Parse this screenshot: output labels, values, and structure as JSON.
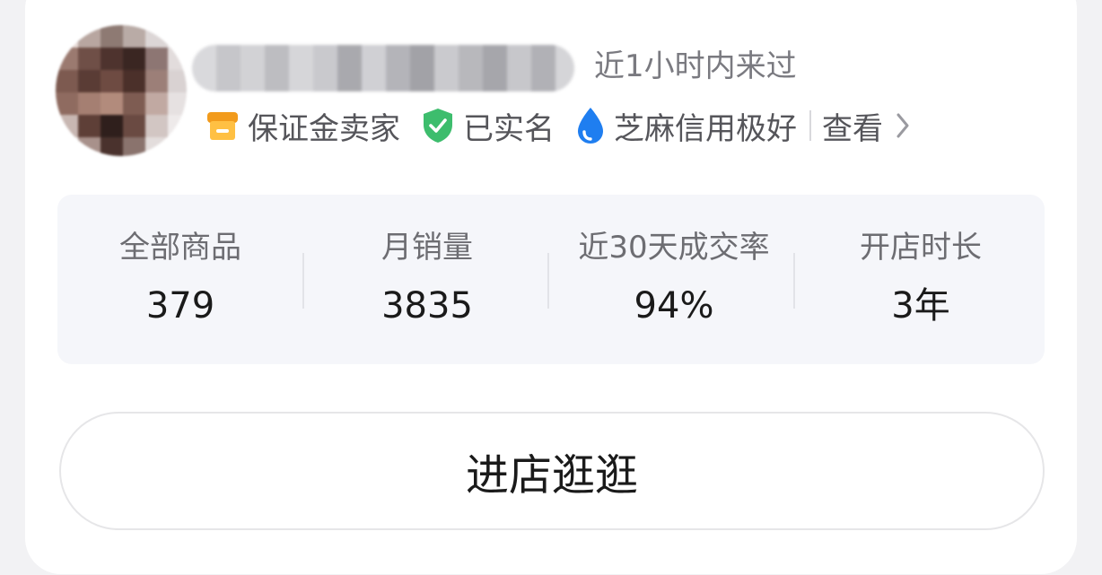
{
  "profile": {
    "last_seen": "近1小时内来过"
  },
  "badges": [
    {
      "icon": "shop-icon",
      "label": "保证金卖家",
      "color": "#f5a623"
    },
    {
      "icon": "shield-check-icon",
      "label": "已实名",
      "color": "#3dbd6d"
    },
    {
      "icon": "sesame-drop-icon",
      "label": "芝麻信用极好",
      "color": "#1f7ef0"
    }
  ],
  "view_link": {
    "label": "查看",
    "icon": "chevron-right-icon"
  },
  "stats": [
    {
      "label": "全部商品",
      "value": "379"
    },
    {
      "label": "月销量",
      "value": "3835"
    },
    {
      "label": "近30天成交率",
      "value": "94%"
    },
    {
      "label": "开店时长",
      "value": "3年"
    }
  ],
  "cta": {
    "label": "进店逛逛"
  }
}
